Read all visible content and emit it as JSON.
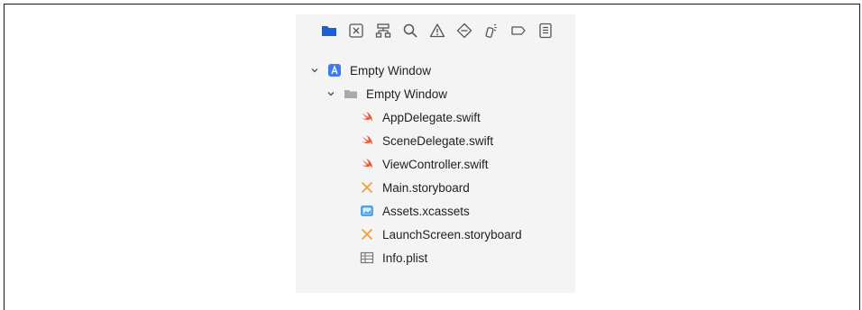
{
  "toolbar": {
    "icons": [
      "folder-icon",
      "source-control-icon",
      "hierarchy-icon",
      "search-icon",
      "warning-icon",
      "test-icon",
      "debug-icon",
      "breakpoint-icon",
      "report-icon"
    ],
    "active": "folder-icon",
    "accent": "#1a5fd6"
  },
  "tree": {
    "project": {
      "label": "Empty Window",
      "icon": "app-project-icon",
      "expanded": true
    },
    "group": {
      "label": "Empty Window",
      "icon": "group-folder-icon",
      "expanded": true
    },
    "files": [
      {
        "label": "AppDelegate.swift",
        "icon": "swift-icon"
      },
      {
        "label": "SceneDelegate.swift",
        "icon": "swift-icon"
      },
      {
        "label": "ViewController.swift",
        "icon": "swift-icon"
      },
      {
        "label": "Main.storyboard",
        "icon": "storyboard-icon"
      },
      {
        "label": "Assets.xcassets",
        "icon": "assets-icon"
      },
      {
        "label": "LaunchScreen.storyboard",
        "icon": "storyboard-icon"
      },
      {
        "label": "Info.plist",
        "icon": "plist-icon"
      }
    ]
  },
  "colors": {
    "swift": "#ef5a3c",
    "storyboard": "#f0a23b",
    "assets": "#4fa3e6",
    "project": "#3d7be8",
    "folder": "#a9a9a9",
    "panel": "#f4f4f4"
  }
}
